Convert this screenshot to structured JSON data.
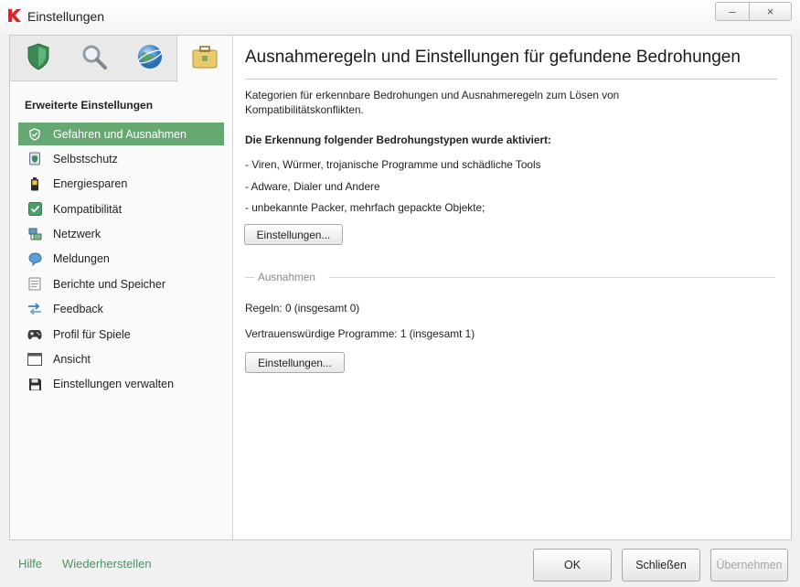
{
  "window": {
    "title": "Einstellungen",
    "minimize": "–",
    "close": "×",
    "logo_icon": "kaspersky-k-icon"
  },
  "sidebar": {
    "tabs": [
      {
        "icon": "shield-icon",
        "selected": false
      },
      {
        "icon": "magnifier-icon",
        "selected": false
      },
      {
        "icon": "globe-icon",
        "selected": false
      },
      {
        "icon": "briefcase-icon",
        "selected": true
      }
    ],
    "heading": "Erweiterte Einstellungen",
    "items": [
      {
        "label": "Gefahren und Ausnahmen",
        "icon": "check-shield-icon",
        "selected": true
      },
      {
        "label": "Selbstschutz",
        "icon": "self-protection-icon"
      },
      {
        "label": "Energiesparen",
        "icon": "battery-icon"
      },
      {
        "label": "Kompatibilität",
        "icon": "check-box-icon"
      },
      {
        "label": "Netzwerk",
        "icon": "network-icon"
      },
      {
        "label": "Meldungen",
        "icon": "notification-icon"
      },
      {
        "label": "Berichte und Speicher",
        "icon": "report-icon"
      },
      {
        "label": "Feedback",
        "icon": "feedback-arrows-icon"
      },
      {
        "label": "Profil für Spiele",
        "icon": "gamepad-icon"
      },
      {
        "label": "Ansicht",
        "icon": "window-icon"
      },
      {
        "label": "Einstellungen verwalten",
        "icon": "floppy-disk-icon"
      }
    ]
  },
  "main": {
    "title": "Ausnahmeregeln und Einstellungen für gefundene Bedrohungen",
    "description_lines": [
      "Kategorien für erkennbare Bedrohungen und Ausnahmeregeln zum Lösen von",
      "Kompatibilitätskonflikten."
    ],
    "detection_heading": "Die Erkennung folgender Bedrohungstypen wurde aktiviert:",
    "detection_list": [
      "- Viren, Würmer, trojanische Programme und schädliche Tools",
      "- Adware, Dialer und Andere",
      "- unbekannte Packer, mehrfach gepackte Objekte;"
    ],
    "settings_button": "Einstellungen...",
    "exceptions": {
      "label": "Ausnahmen",
      "rules": "Regeln: 0 (insgesamt 0)",
      "trusted": "Vertrauenswürdige Programme: 1 (insgesamt 1)",
      "settings_button": "Einstellungen..."
    }
  },
  "footer": {
    "help": "Hilfe",
    "restore": "Wiederherstellen",
    "ok": "OK",
    "close": "Schließen",
    "apply": "Übernehmen",
    "apply_enabled": false
  },
  "colors": {
    "selected_item": "#65a872",
    "link": "#4f8f66",
    "disabled_text": "#a6a6a6"
  }
}
